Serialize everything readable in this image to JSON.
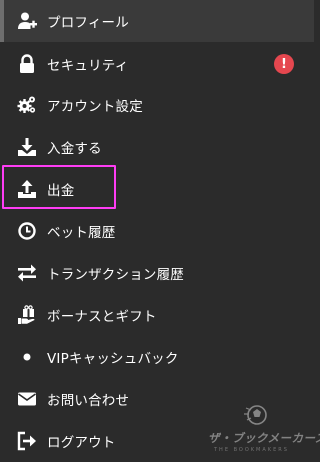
{
  "menu": {
    "items": [
      {
        "label": "プロフィール",
        "icon": "user-plus-icon"
      },
      {
        "label": "セキュリティ",
        "icon": "lock-icon",
        "badge": "!"
      },
      {
        "label": "アカウント設定",
        "icon": "gears-icon"
      },
      {
        "label": "入金する",
        "icon": "download-icon"
      },
      {
        "label": "出金",
        "icon": "upload-icon"
      },
      {
        "label": "ベット履歴",
        "icon": "clock-icon"
      },
      {
        "label": "トランザクション履歴",
        "icon": "exchange-arrows-icon"
      },
      {
        "label": "ボーナスとギフト",
        "icon": "gift-hand-icon"
      },
      {
        "label": "VIPキャッシュバック",
        "icon": "dot-icon"
      },
      {
        "label": "お問い合わせ",
        "icon": "envelope-icon"
      },
      {
        "label": "ログアウト",
        "icon": "sign-out-icon"
      }
    ]
  },
  "watermark": {
    "title": "ザ・ブックメーカーズ",
    "subtitle": "THE BOOKMAKERS"
  },
  "colors": {
    "background": "#2b2b2b",
    "active_row": "#3a3a3a",
    "alert": "#e5474f",
    "highlight": "#ff3df5"
  }
}
